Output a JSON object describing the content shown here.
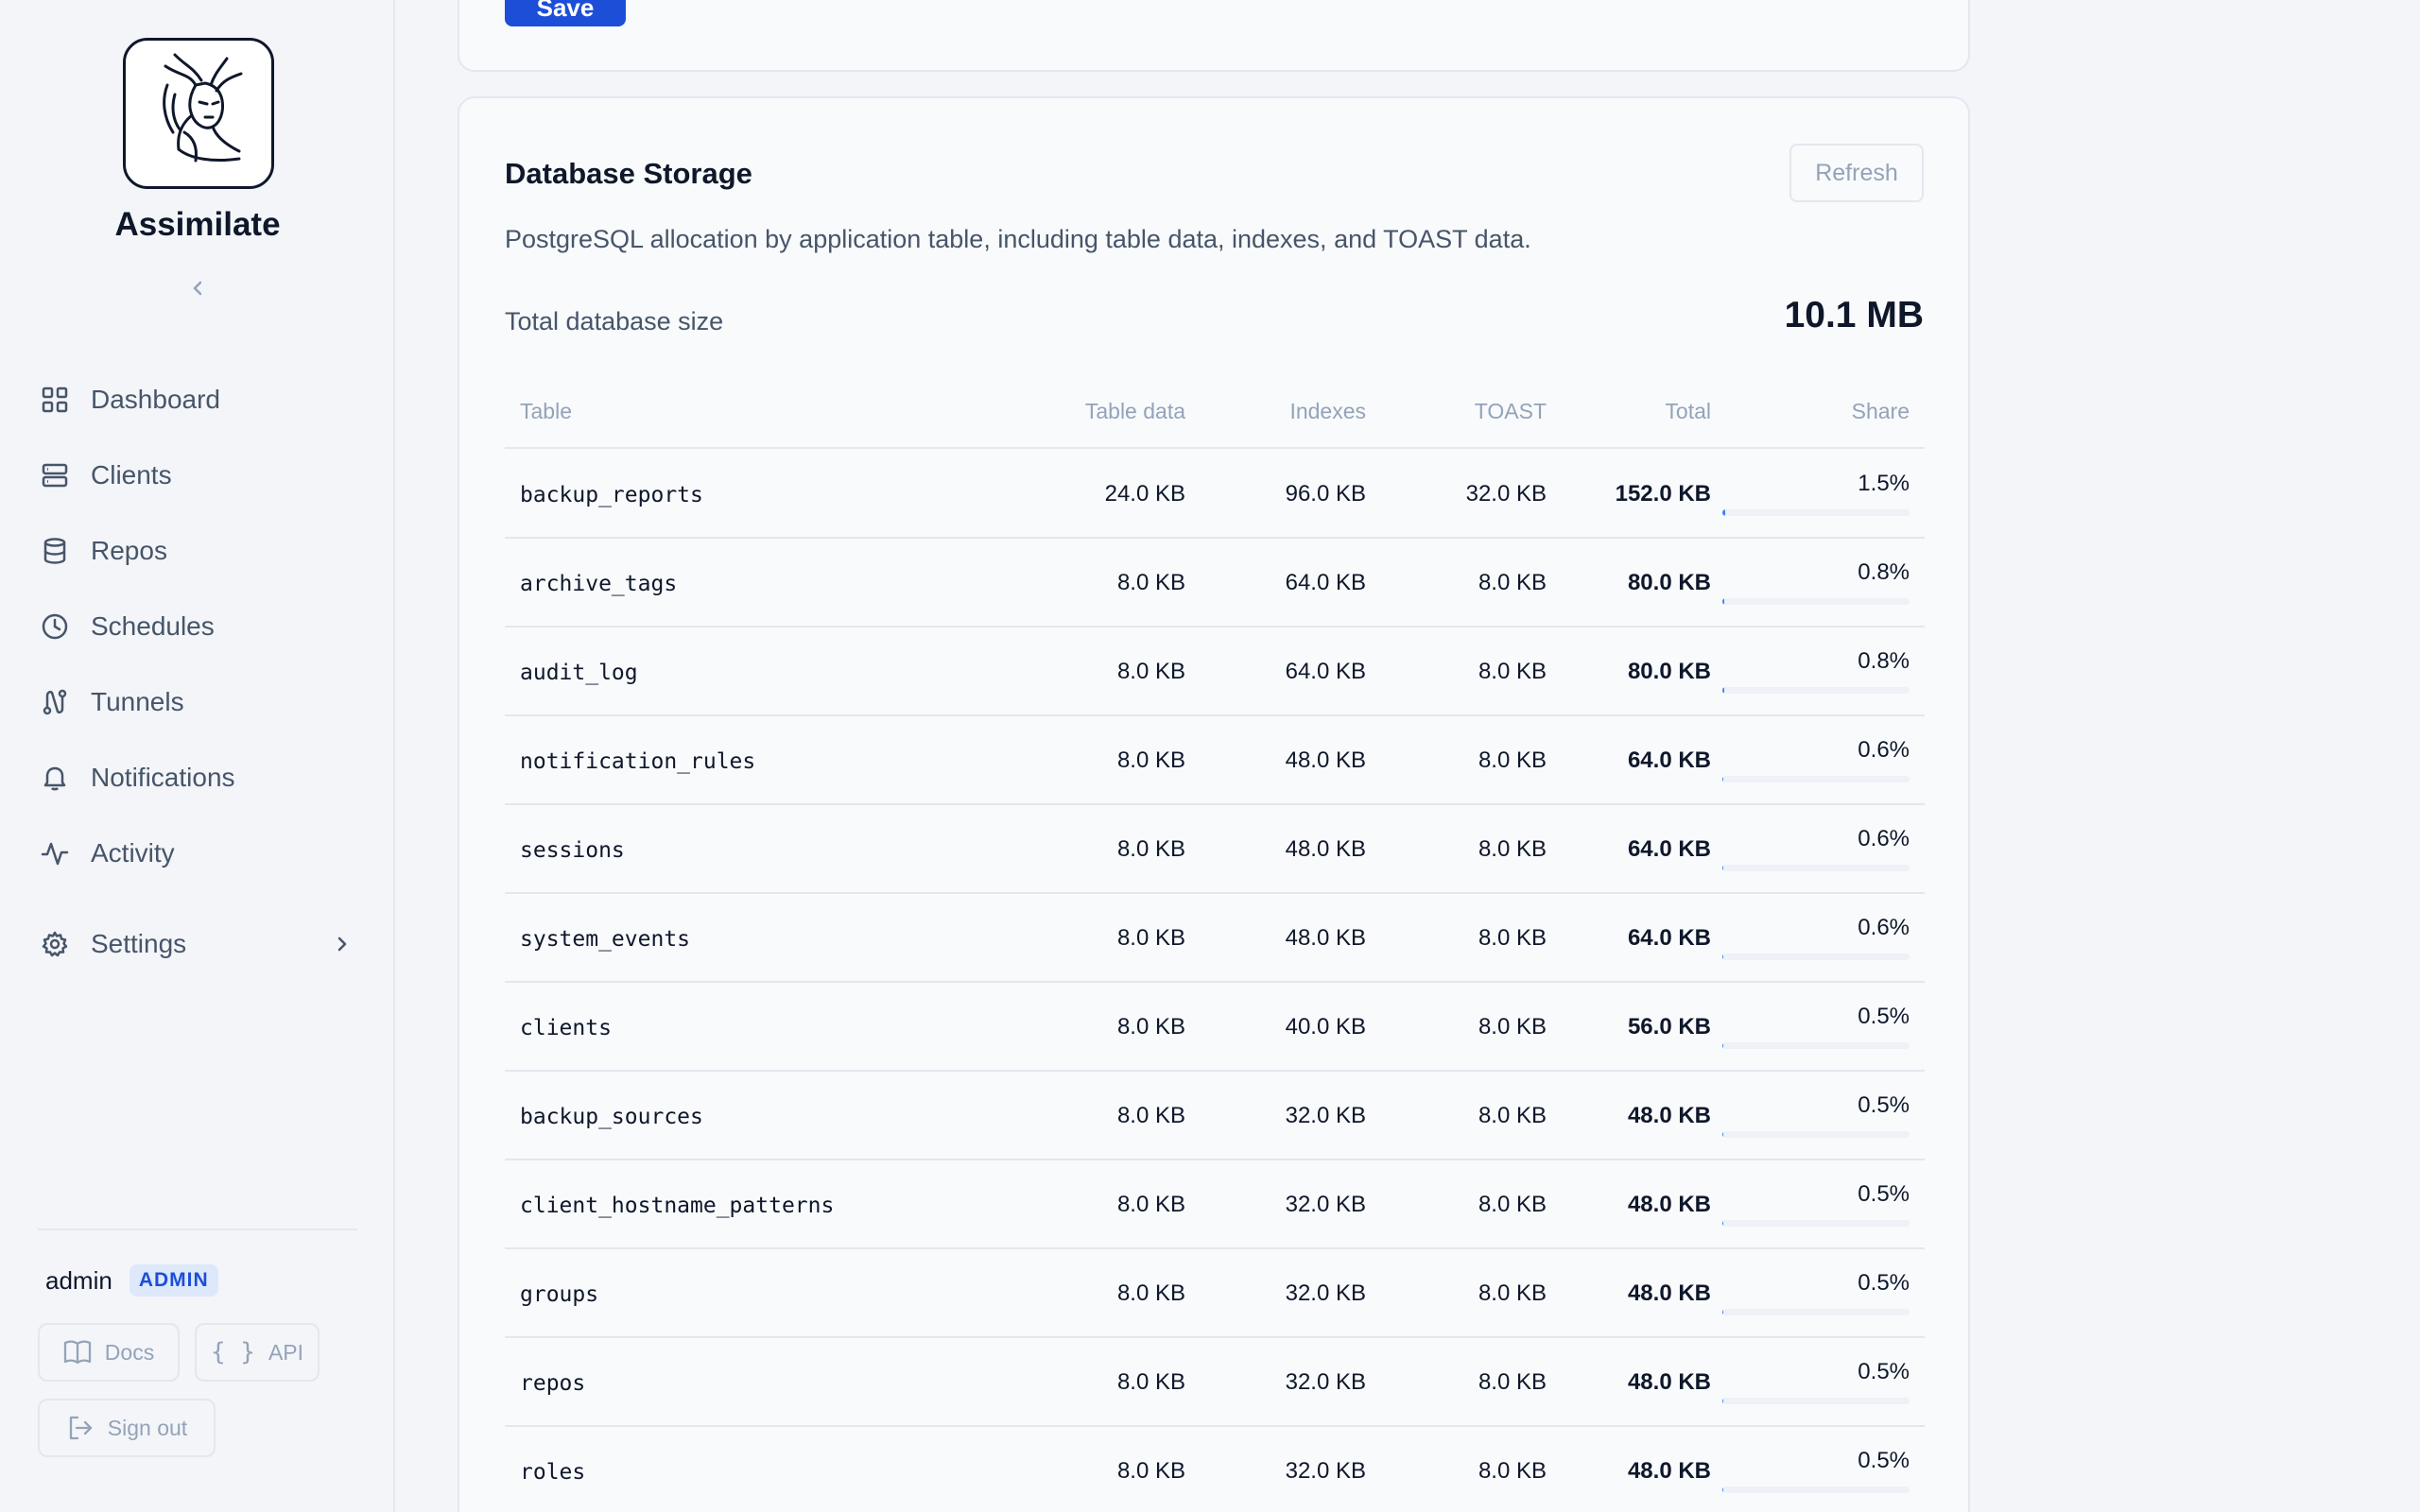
{
  "app": {
    "name": "Assimilate"
  },
  "sidebar": {
    "items": [
      {
        "label": "Dashboard",
        "icon": "grid-icon"
      },
      {
        "label": "Clients",
        "icon": "server-icon"
      },
      {
        "label": "Repos",
        "icon": "database-icon"
      },
      {
        "label": "Schedules",
        "icon": "clock-icon"
      },
      {
        "label": "Tunnels",
        "icon": "route-icon"
      },
      {
        "label": "Notifications",
        "icon": "bell-icon"
      },
      {
        "label": "Activity",
        "icon": "activity-icon"
      },
      {
        "label": "Settings",
        "icon": "gear-icon"
      }
    ],
    "user": {
      "name": "admin",
      "role": "ADMIN"
    },
    "buttons": {
      "docs": "Docs",
      "api": "API",
      "signout": "Sign out"
    }
  },
  "top_card": {
    "save_label": "Save"
  },
  "storage": {
    "title": "Database Storage",
    "refresh_label": "Refresh",
    "description": "PostgreSQL allocation by application table, including table data, indexes, and TOAST data.",
    "total_label": "Total database size",
    "total_value": "10.1 MB",
    "columns": [
      "Table",
      "Table data",
      "Indexes",
      "TOAST",
      "Total",
      "Share"
    ],
    "rows": [
      {
        "name": "backup_reports",
        "data": "24.0 KB",
        "indexes": "96.0 KB",
        "toast": "32.0 KB",
        "total": "152.0 KB",
        "share": "1.5%",
        "share_value": 1.5
      },
      {
        "name": "archive_tags",
        "data": "8.0 KB",
        "indexes": "64.0 KB",
        "toast": "8.0 KB",
        "total": "80.0 KB",
        "share": "0.8%",
        "share_value": 0.8
      },
      {
        "name": "audit_log",
        "data": "8.0 KB",
        "indexes": "64.0 KB",
        "toast": "8.0 KB",
        "total": "80.0 KB",
        "share": "0.8%",
        "share_value": 0.8
      },
      {
        "name": "notification_rules",
        "data": "8.0 KB",
        "indexes": "48.0 KB",
        "toast": "8.0 KB",
        "total": "64.0 KB",
        "share": "0.6%",
        "share_value": 0.6
      },
      {
        "name": "sessions",
        "data": "8.0 KB",
        "indexes": "48.0 KB",
        "toast": "8.0 KB",
        "total": "64.0 KB",
        "share": "0.6%",
        "share_value": 0.6
      },
      {
        "name": "system_events",
        "data": "8.0 KB",
        "indexes": "48.0 KB",
        "toast": "8.0 KB",
        "total": "64.0 KB",
        "share": "0.6%",
        "share_value": 0.6
      },
      {
        "name": "clients",
        "data": "8.0 KB",
        "indexes": "40.0 KB",
        "toast": "8.0 KB",
        "total": "56.0 KB",
        "share": "0.5%",
        "share_value": 0.5
      },
      {
        "name": "backup_sources",
        "data": "8.0 KB",
        "indexes": "32.0 KB",
        "toast": "8.0 KB",
        "total": "48.0 KB",
        "share": "0.5%",
        "share_value": 0.5
      },
      {
        "name": "client_hostname_patterns",
        "data": "8.0 KB",
        "indexes": "32.0 KB",
        "toast": "8.0 KB",
        "total": "48.0 KB",
        "share": "0.5%",
        "share_value": 0.5
      },
      {
        "name": "groups",
        "data": "8.0 KB",
        "indexes": "32.0 KB",
        "toast": "8.0 KB",
        "total": "48.0 KB",
        "share": "0.5%",
        "share_value": 0.5
      },
      {
        "name": "repos",
        "data": "8.0 KB",
        "indexes": "32.0 KB",
        "toast": "8.0 KB",
        "total": "48.0 KB",
        "share": "0.5%",
        "share_value": 0.5
      },
      {
        "name": "roles",
        "data": "8.0 KB",
        "indexes": "32.0 KB",
        "toast": "8.0 KB",
        "total": "48.0 KB",
        "share": "0.5%",
        "share_value": 0.5
      }
    ]
  },
  "colors": {
    "accent": "#1d4ed8",
    "badge_bg": "#dde8fb",
    "bar_fill": "#3b82f6"
  }
}
